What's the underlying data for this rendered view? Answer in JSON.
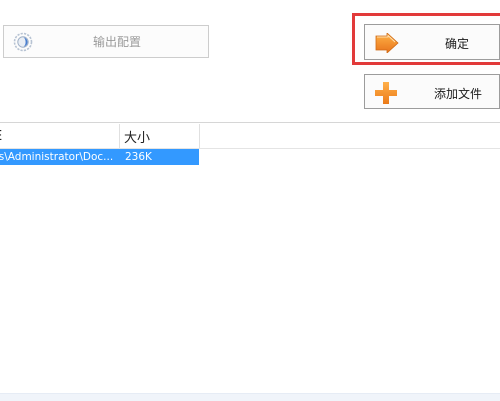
{
  "toolbar": {
    "output_config_label": "输出配置",
    "confirm_label": "确定",
    "add_file_label": "添加文件"
  },
  "file_list": {
    "columns": [
      "E",
      "大小"
    ],
    "rows": [
      {
        "path": "ers\\Administrator\\Doc...",
        "size": "236K"
      }
    ]
  },
  "colors": {
    "highlight": "#e23a3a",
    "selection": "#3399ff",
    "icon_orange": "#f08a24"
  },
  "icons": {
    "output_config": "gear-icon",
    "confirm": "arrow-right-icon",
    "add_file": "plus-icon"
  }
}
